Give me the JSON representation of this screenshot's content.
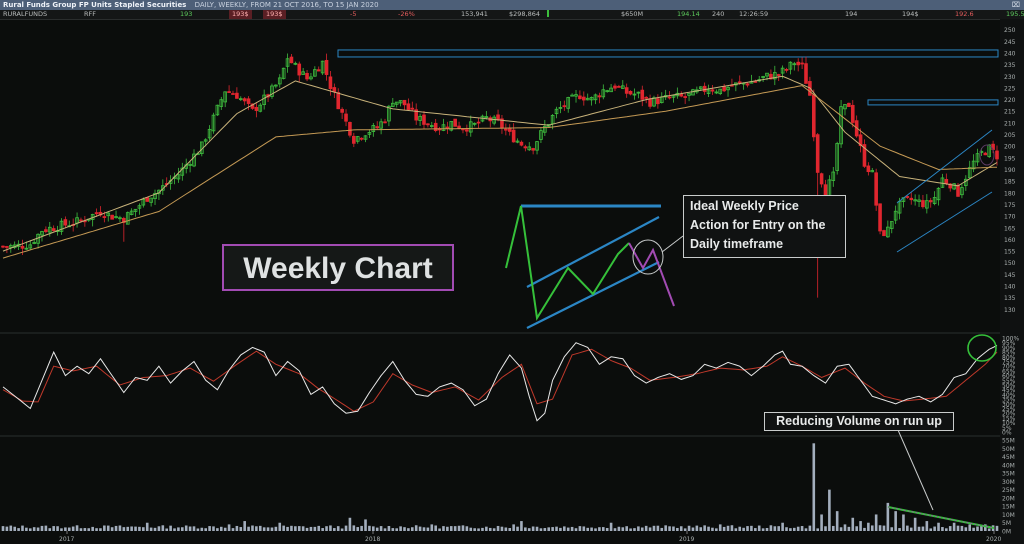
{
  "window": {
    "title": "Rural Funds Group FP Units Stapled Securities",
    "subtitle": "DAILY, WEEKLY, FROM 21 OCT 2016, TO 15 JAN 2020",
    "controls": "⌧"
  },
  "quote_bar": {
    "name": "RURALFUNDS",
    "code": "RFF",
    "bid": "193",
    "bid2": "193$",
    "ask": "193$",
    "change": "-5",
    "change_pct": "-26%",
    "volume": "153,941",
    "value": "$298,864",
    "market_cap": "$650M",
    "high": "194.14",
    "trades": "240",
    "time": "12:26:59",
    "open": "194",
    "close_a": "194$",
    "low": "192.6",
    "last": "195.5"
  },
  "annotations": {
    "weekly": "Weekly Chart",
    "ideal": "Ideal Weekly Price\nAction for Entry on the\nDaily timeframe",
    "volume": "Reducing Volume on run up"
  },
  "colors": {
    "background": "#0b0d0c",
    "up_candle": "#3fbf3f",
    "down_candle": "#e0262f",
    "ma_short": "#c8b27a",
    "ma_long": "#c59a55",
    "stoch_k": "#e8e8e8",
    "stoch_d": "#c0392b",
    "volume_bar": "#a3aebd",
    "channel": "#2b86c5",
    "highlight": "#35c03a",
    "marker": "#a24bb3"
  },
  "chart_data": [
    {
      "type": "candlestick",
      "title": "",
      "y_ticks": [
        130,
        135,
        140,
        145,
        150,
        155,
        160,
        165,
        170,
        175,
        180,
        185,
        190,
        195,
        200,
        205,
        210,
        215,
        220,
        225,
        230,
        235,
        240,
        245,
        250
      ],
      "x_ticks": [
        "2017",
        "2018",
        "2019",
        "2020"
      ],
      "ylim": [
        128,
        252
      ],
      "resistance_levels": [
        240,
        219
      ],
      "close_anchors": [
        [
          0,
          157
        ],
        [
          3,
          157
        ],
        [
          7,
          158
        ],
        [
          10,
          164
        ],
        [
          15,
          166
        ],
        [
          20,
          168
        ],
        [
          25,
          172
        ],
        [
          28,
          170
        ],
        [
          31,
          169
        ],
        [
          34,
          173
        ],
        [
          37,
          178
        ],
        [
          40,
          181
        ],
        [
          45,
          188
        ],
        [
          48,
          194
        ],
        [
          51,
          200
        ],
        [
          54,
          212
        ],
        [
          57,
          224
        ],
        [
          60,
          222
        ],
        [
          64,
          215
        ],
        [
          68,
          222
        ],
        [
          71,
          228
        ],
        [
          73,
          238
        ],
        [
          75,
          234
        ],
        [
          78,
          229
        ],
        [
          82,
          236
        ],
        [
          84,
          226
        ],
        [
          87,
          214
        ],
        [
          90,
          203
        ],
        [
          93,
          206
        ],
        [
          96,
          208
        ],
        [
          98,
          212
        ],
        [
          100,
          220
        ],
        [
          103,
          218
        ],
        [
          106,
          212
        ],
        [
          109,
          210
        ],
        [
          112,
          208
        ],
        [
          115,
          210
        ],
        [
          118,
          208
        ],
        [
          121,
          209
        ],
        [
          124,
          212
        ],
        [
          127,
          210
        ],
        [
          130,
          205
        ],
        [
          133,
          201
        ],
        [
          136,
          200
        ],
        [
          139,
          208
        ],
        [
          142,
          215
        ],
        [
          145,
          219
        ],
        [
          148,
          222
        ],
        [
          151,
          220
        ],
        [
          154,
          224
        ],
        [
          157,
          226
        ],
        [
          160,
          223
        ],
        [
          163,
          222
        ],
        [
          166,
          219
        ],
        [
          169,
          220
        ],
        [
          172,
          221
        ],
        [
          175,
          221
        ],
        [
          178,
          223
        ],
        [
          181,
          225
        ],
        [
          184,
          224
        ],
        [
          187,
          226
        ],
        [
          190,
          227
        ],
        [
          193,
          228
        ],
        [
          196,
          230
        ],
        [
          199,
          231
        ],
        [
          201,
          233
        ],
        [
          203,
          236
        ],
        [
          205,
          234
        ],
        [
          207,
          222
        ],
        [
          209,
          190
        ],
        [
          211,
          181
        ],
        [
          213,
          187
        ],
        [
          215,
          215
        ],
        [
          217,
          218
        ],
        [
          219,
          205
        ],
        [
          221,
          193
        ],
        [
          223,
          188
        ],
        [
          225,
          162
        ],
        [
          227,
          164
        ],
        [
          229,
          173
        ],
        [
          231,
          176
        ],
        [
          233,
          177
        ],
        [
          235,
          176
        ],
        [
          237,
          175
        ],
        [
          239,
          178
        ],
        [
          241,
          186
        ],
        [
          243,
          184
        ],
        [
          245,
          180
        ],
        [
          247,
          187
        ],
        [
          249,
          193
        ],
        [
          251,
          197
        ],
        [
          253,
          199
        ],
        [
          255,
          196
        ]
      ],
      "ma_fast_anchors": [
        [
          0,
          155
        ],
        [
          40,
          180
        ],
        [
          60,
          214
        ],
        [
          75,
          228
        ],
        [
          100,
          216
        ],
        [
          140,
          209
        ],
        [
          165,
          220
        ],
        [
          200,
          230
        ],
        [
          207,
          225
        ],
        [
          216,
          206
        ],
        [
          230,
          187
        ],
        [
          245,
          183
        ],
        [
          255,
          193
        ]
      ],
      "ma_slow_anchors": [
        [
          0,
          152
        ],
        [
          40,
          172
        ],
        [
          70,
          204
        ],
        [
          90,
          207
        ],
        [
          140,
          208
        ],
        [
          170,
          215
        ],
        [
          205,
          226
        ],
        [
          212,
          217
        ],
        [
          225,
          200
        ],
        [
          240,
          190
        ],
        [
          255,
          191
        ]
      ]
    },
    {
      "type": "line",
      "title": "",
      "y_ticks": [
        "0%",
        "5%",
        "10%",
        "15%",
        "20%",
        "25%",
        "30%",
        "35%",
        "40%",
        "45%",
        "50%",
        "55%",
        "60%",
        "65%",
        "70%",
        "75%",
        "80%",
        "85%",
        "90%",
        "95%",
        "100%"
      ],
      "ylim": [
        0,
        100
      ],
      "series_k_anchors": [
        [
          0,
          48
        ],
        [
          4,
          35
        ],
        [
          7,
          25
        ],
        [
          10,
          55
        ],
        [
          13,
          85
        ],
        [
          16,
          60
        ],
        [
          19,
          70
        ],
        [
          22,
          62
        ],
        [
          25,
          78
        ],
        [
          28,
          60
        ],
        [
          31,
          42
        ],
        [
          34,
          58
        ],
        [
          37,
          55
        ],
        [
          40,
          70
        ],
        [
          43,
          52
        ],
        [
          46,
          65
        ],
        [
          49,
          75
        ],
        [
          52,
          55
        ],
        [
          55,
          45
        ],
        [
          58,
          66
        ],
        [
          61,
          82
        ],
        [
          64,
          90
        ],
        [
          67,
          85
        ],
        [
          70,
          60
        ],
        [
          73,
          75
        ],
        [
          76,
          65
        ],
        [
          79,
          40
        ],
        [
          82,
          48
        ],
        [
          85,
          30
        ],
        [
          88,
          20
        ],
        [
          91,
          22
        ],
        [
          94,
          42
        ],
        [
          97,
          60
        ],
        [
          100,
          75
        ],
        [
          103,
          55
        ],
        [
          106,
          40
        ],
        [
          109,
          38
        ],
        [
          112,
          48
        ],
        [
          115,
          52
        ],
        [
          118,
          45
        ],
        [
          121,
          28
        ],
        [
          124,
          35
        ],
        [
          127,
          62
        ],
        [
          130,
          82
        ],
        [
          133,
          68
        ],
        [
          135,
          38
        ],
        [
          137,
          12
        ],
        [
          139,
          20
        ],
        [
          141,
          55
        ],
        [
          144,
          80
        ],
        [
          147,
          95
        ],
        [
          150,
          90
        ],
        [
          153,
          72
        ],
        [
          156,
          80
        ],
        [
          159,
          78
        ],
        [
          162,
          60
        ],
        [
          165,
          52
        ],
        [
          168,
          58
        ],
        [
          171,
          62
        ],
        [
          174,
          56
        ],
        [
          177,
          60
        ],
        [
          180,
          72
        ],
        [
          183,
          68
        ],
        [
          186,
          74
        ],
        [
          189,
          70
        ],
        [
          192,
          60
        ],
        [
          195,
          70
        ],
        [
          198,
          82
        ],
        [
          200,
          86
        ],
        [
          202,
          72
        ],
        [
          205,
          70
        ],
        [
          208,
          60
        ],
        [
          211,
          52
        ],
        [
          214,
          70
        ],
        [
          217,
          72
        ],
        [
          220,
          55
        ],
        [
          223,
          38
        ],
        [
          226,
          34
        ],
        [
          229,
          30
        ],
        [
          232,
          35
        ],
        [
          235,
          38
        ],
        [
          238,
          32
        ],
        [
          241,
          40
        ],
        [
          244,
          58
        ],
        [
          247,
          62
        ],
        [
          250,
          78
        ],
        [
          253,
          88
        ],
        [
          255,
          92
        ]
      ],
      "series_d_anchors": [
        [
          0,
          45
        ],
        [
          5,
          33
        ],
        [
          9,
          32
        ],
        [
          13,
          70
        ],
        [
          18,
          65
        ],
        [
          24,
          70
        ],
        [
          30,
          50
        ],
        [
          36,
          58
        ],
        [
          42,
          60
        ],
        [
          48,
          68
        ],
        [
          54,
          54
        ],
        [
          60,
          72
        ],
        [
          65,
          86
        ],
        [
          70,
          72
        ],
        [
          76,
          62
        ],
        [
          81,
          46
        ],
        [
          86,
          33
        ],
        [
          90,
          22
        ],
        [
          95,
          32
        ],
        [
          100,
          62
        ],
        [
          105,
          50
        ],
        [
          110,
          42
        ],
        [
          116,
          48
        ],
        [
          122,
          34
        ],
        [
          128,
          58
        ],
        [
          133,
          72
        ],
        [
          137,
          30
        ],
        [
          141,
          35
        ],
        [
          146,
          82
        ],
        [
          151,
          88
        ],
        [
          156,
          76
        ],
        [
          161,
          68
        ],
        [
          166,
          55
        ],
        [
          172,
          58
        ],
        [
          178,
          62
        ],
        [
          184,
          68
        ],
        [
          190,
          66
        ],
        [
          196,
          70
        ],
        [
          200,
          80
        ],
        [
          205,
          70
        ],
        [
          210,
          58
        ],
        [
          216,
          68
        ],
        [
          221,
          52
        ],
        [
          226,
          38
        ],
        [
          231,
          33
        ],
        [
          236,
          35
        ],
        [
          242,
          38
        ],
        [
          247,
          55
        ],
        [
          252,
          72
        ],
        [
          255,
          85
        ]
      ]
    },
    {
      "type": "bar",
      "title": "",
      "y_ticks": [
        "0M",
        "5M",
        "10M",
        "15M",
        "20M",
        "25M",
        "30M",
        "35M",
        "40M",
        "45M",
        "50M",
        "55M"
      ],
      "ylim": [
        0,
        55
      ],
      "spikes": [
        [
          37,
          5
        ],
        [
          58,
          4
        ],
        [
          62,
          6
        ],
        [
          71,
          5
        ],
        [
          89,
          8
        ],
        [
          93,
          7
        ],
        [
          110,
          4
        ],
        [
          131,
          4
        ],
        [
          133,
          6
        ],
        [
          156,
          5
        ],
        [
          184,
          4
        ],
        [
          200,
          5
        ],
        [
          208,
          53
        ],
        [
          210,
          10
        ],
        [
          212,
          25
        ],
        [
          214,
          12
        ],
        [
          216,
          4
        ],
        [
          218,
          8
        ],
        [
          220,
          6
        ],
        [
          222,
          5
        ],
        [
          224,
          10
        ],
        [
          227,
          17
        ],
        [
          229,
          12
        ],
        [
          231,
          10
        ],
        [
          234,
          8
        ],
        [
          237,
          6
        ],
        [
          240,
          5
        ],
        [
          244,
          5
        ],
        [
          248,
          4
        ],
        [
          252,
          4
        ]
      ],
      "base_volume_m": 2.5
    }
  ]
}
